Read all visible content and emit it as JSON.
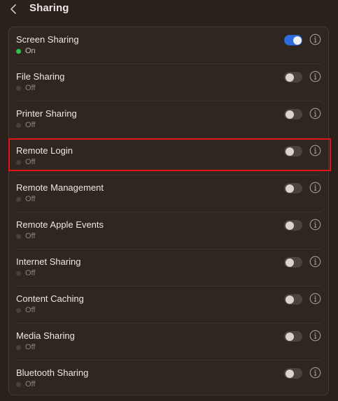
{
  "header": {
    "title": "Sharing",
    "back_icon": "chevron-left-icon"
  },
  "colors": {
    "background": "#2a211d",
    "panel": "#302621",
    "toggle_on": "#2c6be0",
    "status_on": "#2fc24a",
    "highlight": "#e0141b"
  },
  "services": [
    {
      "name": "Screen Sharing",
      "status": "On",
      "enabled": true
    },
    {
      "name": "File Sharing",
      "status": "Off",
      "enabled": false
    },
    {
      "name": "Printer Sharing",
      "status": "Off",
      "enabled": false
    },
    {
      "name": "Remote Login",
      "status": "Off",
      "enabled": false,
      "highlighted": true
    },
    {
      "name": "Remote Management",
      "status": "Off",
      "enabled": false
    },
    {
      "name": "Remote Apple Events",
      "status": "Off",
      "enabled": false
    },
    {
      "name": "Internet Sharing",
      "status": "Off",
      "enabled": false
    },
    {
      "name": "Content Caching",
      "status": "Off",
      "enabled": false
    },
    {
      "name": "Media Sharing",
      "status": "Off",
      "enabled": false
    },
    {
      "name": "Bluetooth Sharing",
      "status": "Off",
      "enabled": false
    }
  ]
}
